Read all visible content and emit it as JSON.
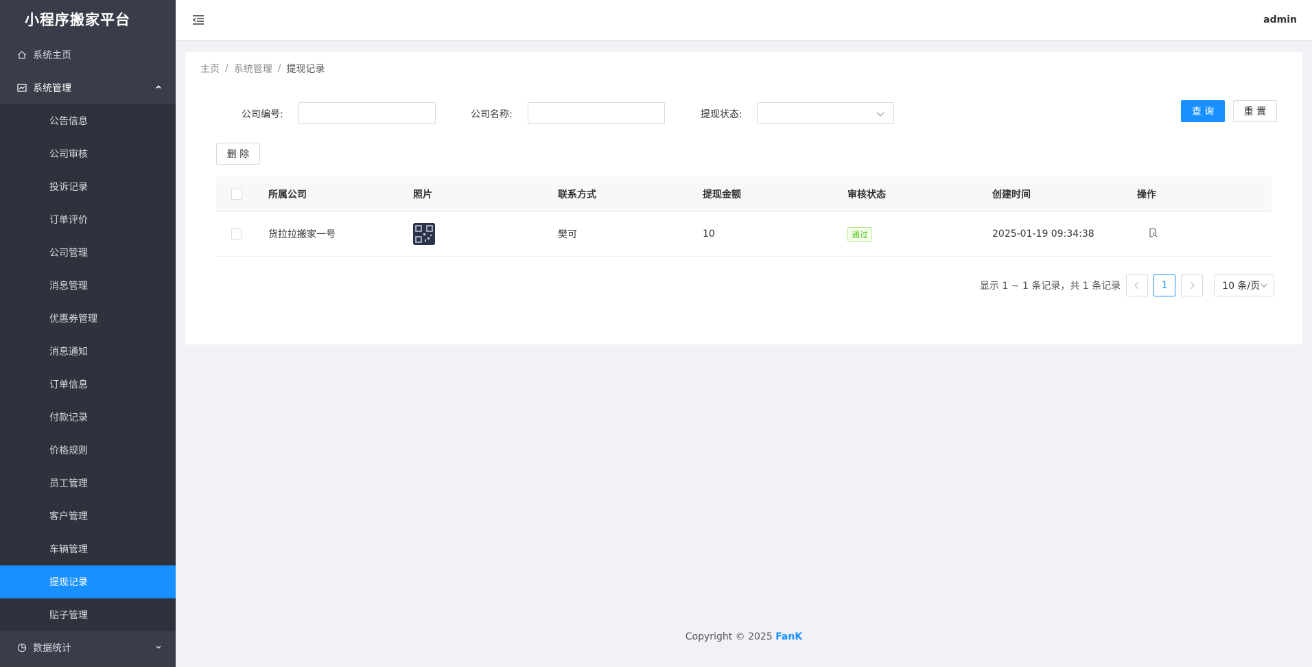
{
  "app": {
    "title": "小程序搬家平台"
  },
  "header": {
    "user": "admin"
  },
  "sidebar": {
    "home": {
      "label": "系统主页",
      "icon": "home-icon"
    },
    "system": {
      "label": "系统管理",
      "icon": "chart-line-icon"
    },
    "system_items": [
      "公告信息",
      "公司审核",
      "投诉记录",
      "订单评价",
      "公司管理",
      "消息管理",
      "优惠券管理",
      "消息通知",
      "订单信息",
      "付款记录",
      "价格规则",
      "员工管理",
      "客户管理",
      "车辆管理",
      "提现记录",
      "贴子管理"
    ],
    "active_item": "提现记录",
    "stats": {
      "label": "数据统计",
      "icon": "pie-chart-icon"
    }
  },
  "breadcrumb": {
    "home": "主页",
    "parent": "系统管理",
    "current": "提现记录"
  },
  "search": {
    "company_id_label": "公司编号:",
    "company_id_value": "",
    "company_name_label": "公司名称:",
    "company_name_value": "",
    "status_label": "提现状态:",
    "status_value": "",
    "query_button": "查 询",
    "reset_button": "重 置"
  },
  "toolbar": {
    "delete_button": "删 除"
  },
  "table": {
    "columns": [
      "所属公司",
      "照片",
      "联系方式",
      "提现金额",
      "审核状态",
      "创建时间",
      "操作"
    ],
    "rows": [
      {
        "company": "货拉拉搬家一号",
        "contact": "樊可",
        "amount": "10",
        "status": "通过",
        "created": "2025-01-19 09:34:38"
      }
    ]
  },
  "pagination": {
    "summary": "显示 1 ~ 1 条记录，共 1 条记录",
    "current_page": "1",
    "page_size": "10 条/页"
  },
  "footer": {
    "copyright": "Copyright © 2025",
    "brand": "FanK"
  },
  "colors": {
    "accent": "#1890ff",
    "sidebar_bg": "#393d49",
    "success": "#52c41a"
  }
}
